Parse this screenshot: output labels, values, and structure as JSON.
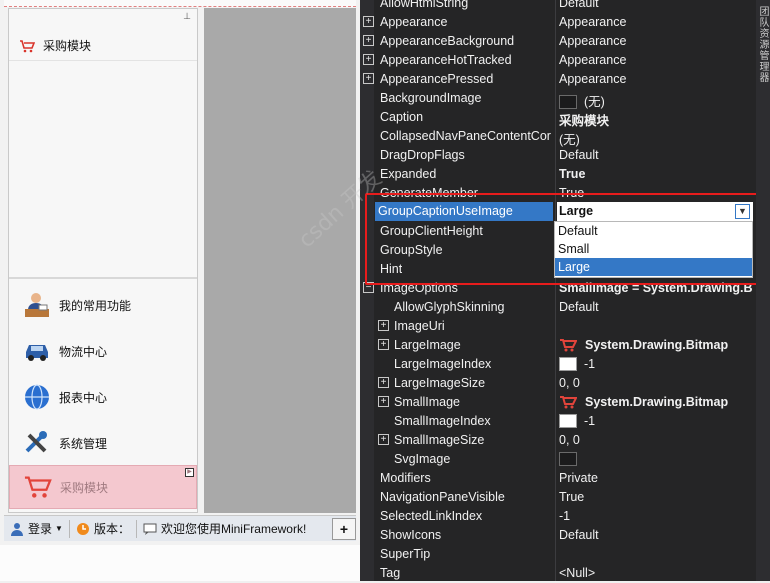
{
  "navbar": {
    "group_header": "采购模块",
    "items": [
      {
        "label": "我的常用功能",
        "icon": "user-desk-icon"
      },
      {
        "label": "物流中心",
        "icon": "car-icon"
      },
      {
        "label": "报表中心",
        "icon": "globe-icon"
      },
      {
        "label": "系统管理",
        "icon": "tools-icon"
      },
      {
        "label": "采购模块",
        "icon": "cart-icon"
      }
    ]
  },
  "statusbar": {
    "login": "登录",
    "version": "版本：",
    "welcome": "欢迎您使用MiniFramework!"
  },
  "properties": {
    "rows": [
      {
        "name": "AllowHtmlString",
        "value": "Default"
      },
      {
        "name": "Appearance",
        "value": "Appearance"
      },
      {
        "name": "AppearanceBackground",
        "value": "Appearance"
      },
      {
        "name": "AppearanceHotTracked",
        "value": "Appearance"
      },
      {
        "name": "AppearancePressed",
        "value": "Appearance"
      },
      {
        "name": "BackgroundImage",
        "value": "(无)"
      },
      {
        "name": "Caption",
        "value": "采购模块"
      },
      {
        "name": "CollapsedNavPaneContentCor",
        "value": "(无)"
      },
      {
        "name": "DragDropFlags",
        "value": "Default"
      },
      {
        "name": "Expanded",
        "value": "True"
      },
      {
        "name": "GenerateMember",
        "value": "True"
      },
      {
        "name": "GroupCaptionUseImage",
        "value": "Large"
      },
      {
        "name": "GroupClientHeight",
        "value": ""
      },
      {
        "name": "GroupStyle",
        "value": ""
      },
      {
        "name": "Hint",
        "value": ""
      },
      {
        "name": "ImageOptions",
        "value": "SmallImage = System.Drawing.B"
      },
      {
        "name": "AllowGlyphSkinning",
        "value": "Default"
      },
      {
        "name": "ImageUri",
        "value": ""
      },
      {
        "name": "LargeImage",
        "value": "System.Drawing.Bitmap"
      },
      {
        "name": "LargeImageIndex",
        "value": "-1"
      },
      {
        "name": "LargeImageSize",
        "value": "0, 0"
      },
      {
        "name": "SmallImage",
        "value": "System.Drawing.Bitmap"
      },
      {
        "name": "SmallImageIndex",
        "value": "-1"
      },
      {
        "name": "SmallImageSize",
        "value": "0, 0"
      },
      {
        "name": "SvgImage",
        "value": ""
      },
      {
        "name": "Modifiers",
        "value": "Private"
      },
      {
        "name": "NavigationPaneVisible",
        "value": "True"
      },
      {
        "name": "SelectedLinkIndex",
        "value": "-1"
      },
      {
        "name": "ShowIcons",
        "value": "Default"
      },
      {
        "name": "SuperTip",
        "value": ""
      },
      {
        "name": "Tag",
        "value": "<Null>"
      }
    ],
    "dropdown_options": [
      "Default",
      "Small",
      "Large"
    ]
  },
  "side_tab": "团队资源管理器",
  "watermark": "csdn 开发"
}
